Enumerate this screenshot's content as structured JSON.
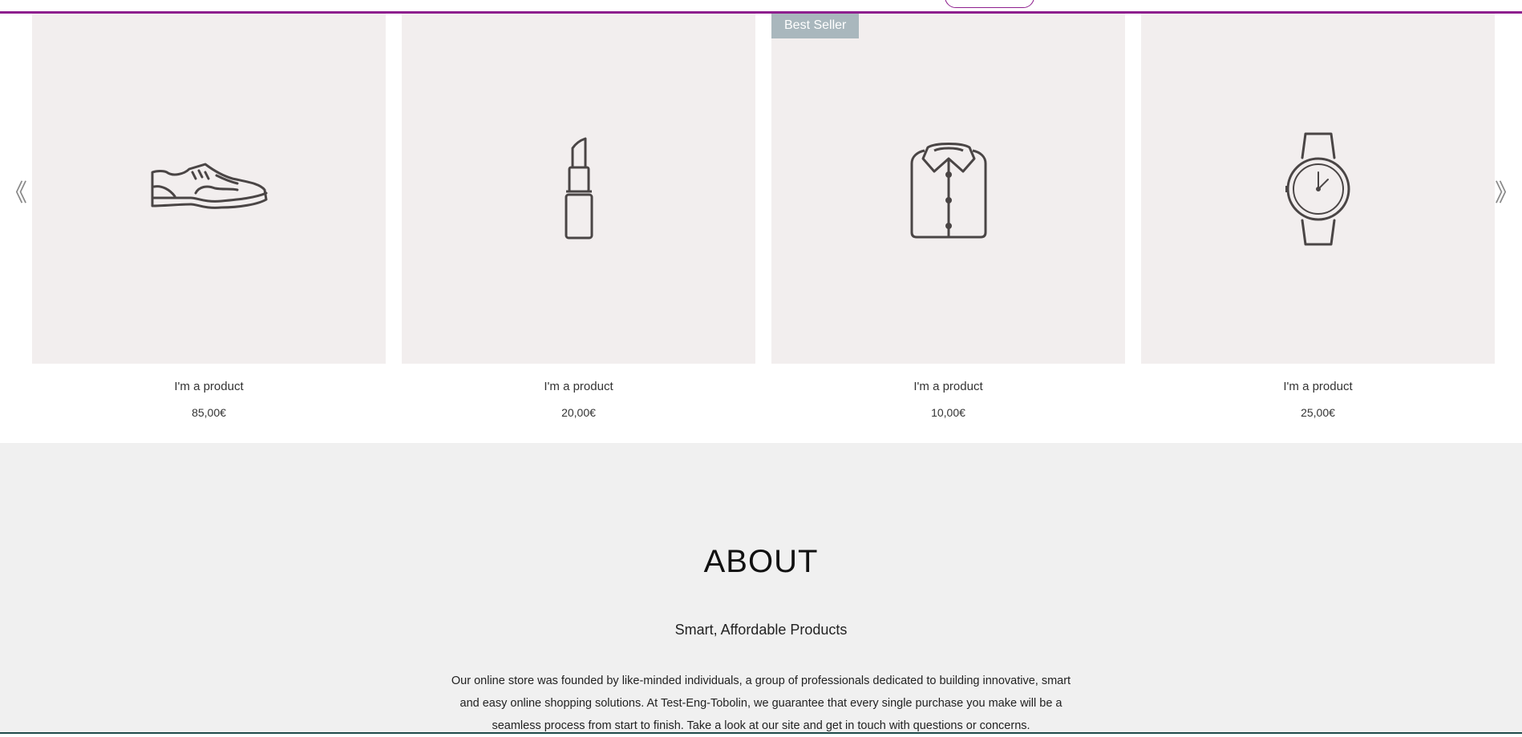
{
  "slider": {
    "prev_glyph": "《",
    "next_glyph": "》",
    "products": [
      {
        "name": "I'm a product",
        "price": "85,00€",
        "icon": "shoe-icon",
        "badge": ""
      },
      {
        "name": "I'm a product",
        "price": "20,00€",
        "icon": "lipstick-icon",
        "badge": ""
      },
      {
        "name": "I'm a product",
        "price": "10,00€",
        "icon": "shirt-icon",
        "badge": "Best Seller"
      },
      {
        "name": "I'm a product",
        "price": "25,00€",
        "icon": "watch-icon",
        "badge": ""
      }
    ]
  },
  "about": {
    "title": "ABOUT",
    "subtitle": "Smart, Affordable Products",
    "body": "Our online store was founded by like-minded individuals, a group of professionals dedicated to building innovative, smart and easy online shopping solutions. At Test-Eng-Tobolin, we guarantee that every single purchase you make will be a seamless process from start to finish. Take a look at our site and get in touch with questions or concerns."
  },
  "colors": {
    "accent": "#8e1f8e",
    "card_bg": "#f2eeee",
    "badge_bg": "#a9b7bd",
    "about_bg": "#f0f0f0"
  }
}
